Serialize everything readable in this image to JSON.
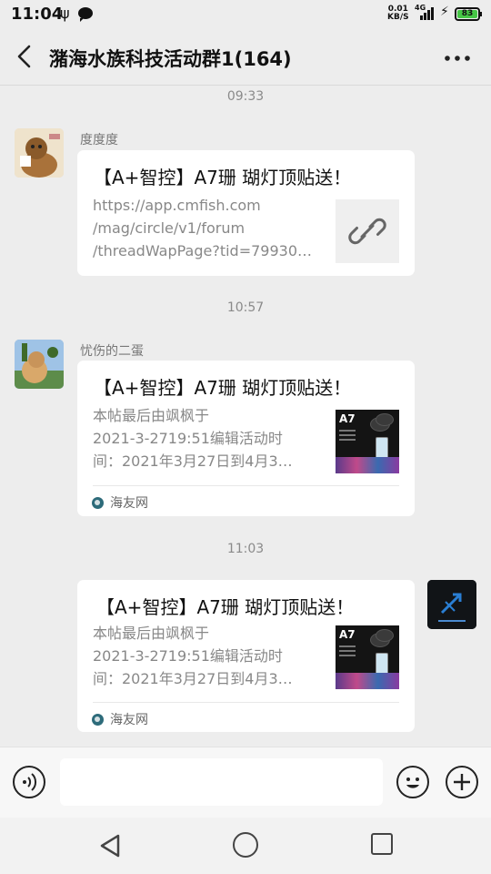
{
  "status_bar": {
    "time": "11:04",
    "net_speed_value": "0.01",
    "net_speed_unit": "KB/S",
    "network_type": "4G",
    "battery_level": "83",
    "battery_color": "#46c646"
  },
  "header": {
    "title": "潴海水族科技活动群1(164)",
    "back_icon": "chevron-left-icon",
    "more_icon": "more-dots-icon"
  },
  "messages": [
    {
      "timestamp": "09:33",
      "sender": "度度度",
      "direction": "incoming",
      "card": {
        "title": "【A+智控】A7珊 瑚灯顶贴送！",
        "desc_lines": [
          "https://app.cmfish.com",
          "/mag/circle/v1/forum",
          "/threadWapPage?tid=79930…"
        ],
        "thumb_icon": "link-icon"
      }
    },
    {
      "timestamp": "10:57",
      "sender": "忧伤的二蛋",
      "direction": "incoming",
      "card": {
        "title": "【A+智控】A7珊 瑚灯顶贴送！",
        "desc_lines": [
          "本帖最后由飒枫于",
          "2021-3-2719:51编辑活动时",
          "间：2021年3月27日到4月3…"
        ],
        "thumb_label": "A7",
        "source": "海友网"
      }
    },
    {
      "timestamp": "11:03",
      "direction": "outgoing",
      "card": {
        "title": "【A+智控】A7珊 瑚灯顶贴送！",
        "desc_lines": [
          "本帖最后由飒枫于",
          "2021-3-2719:51编辑活动时",
          "间：2021年3月27日到4月3…"
        ],
        "thumb_label": "A7",
        "source": "海友网"
      }
    }
  ],
  "input_bar": {
    "voice_icon": "voice-icon",
    "emoji_icon": "emoji-icon",
    "plus_icon": "plus-icon",
    "input_value": ""
  },
  "nav_bar": {
    "back_icon": "triangle-back-icon",
    "home_icon": "circle-home-icon",
    "recent_icon": "square-recent-icon"
  }
}
